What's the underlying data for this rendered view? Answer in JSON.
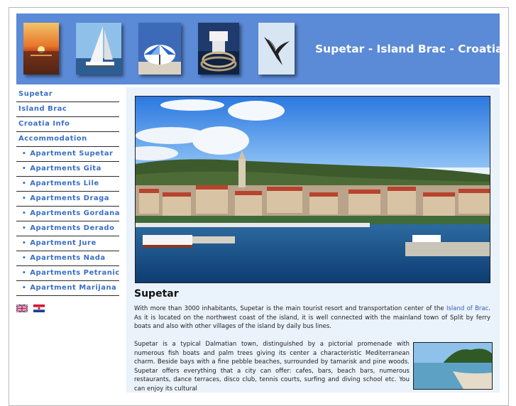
{
  "header": {
    "title": "Supetar - Island Brac - Croatia",
    "thumbnails": [
      "sunset",
      "sailboat",
      "umbrella",
      "bollard",
      "seagull"
    ]
  },
  "nav": {
    "items": [
      {
        "label": "Supetar",
        "sub": false
      },
      {
        "label": "Island Brac",
        "sub": false
      },
      {
        "label": "Croatia Info",
        "sub": false
      },
      {
        "label": "Accommodation",
        "sub": false
      },
      {
        "label": "Apartment Supetar",
        "sub": true
      },
      {
        "label": "Apartments Gita",
        "sub": true
      },
      {
        "label": "Apartments Lile",
        "sub": true
      },
      {
        "label": "Apartments Draga",
        "sub": true
      },
      {
        "label": "Apartments Gordana",
        "sub": true
      },
      {
        "label": "Apartments Derado",
        "sub": true
      },
      {
        "label": "Apartment Jure",
        "sub": true
      },
      {
        "label": "Apartments Nada",
        "sub": true
      },
      {
        "label": "Apartments Petranic",
        "sub": true
      },
      {
        "label": "Apartment Marijana",
        "sub": true
      }
    ],
    "bullet": "•"
  },
  "flags": [
    "english-flag",
    "croatian-flag"
  ],
  "main": {
    "title": "Supetar",
    "para1_before": "With more than 3000 inhabitants, Supetar is the main tourist resort and transportation center of the ",
    "para1_link": "Island of Brac",
    "para1_after": ". As it is located on the northwest coast of the island, it is well connected with the mainland town of Split by ferry boats and also with other villages of the island by daily bus lines.",
    "para2": "Supetar is a typical Dalmatian town, distinguished by a pictorial promenade with numerous fish boats and palm trees giving its center a characteristic Mediterranean charm. Beside bays with a fine pebble beaches, surrounded by tamarisk and pine woods. Supetar offers everything that a city can offer: cafes, bars, beach bars, numerous restaurants, dance terraces, disco club, tennis courts, surfing and diving school etc. You can enjoy its cultural"
  },
  "colors": {
    "header_bg": "#5b8ad6",
    "link": "#3a6fc7",
    "content_bg": "#eaf2fb"
  }
}
